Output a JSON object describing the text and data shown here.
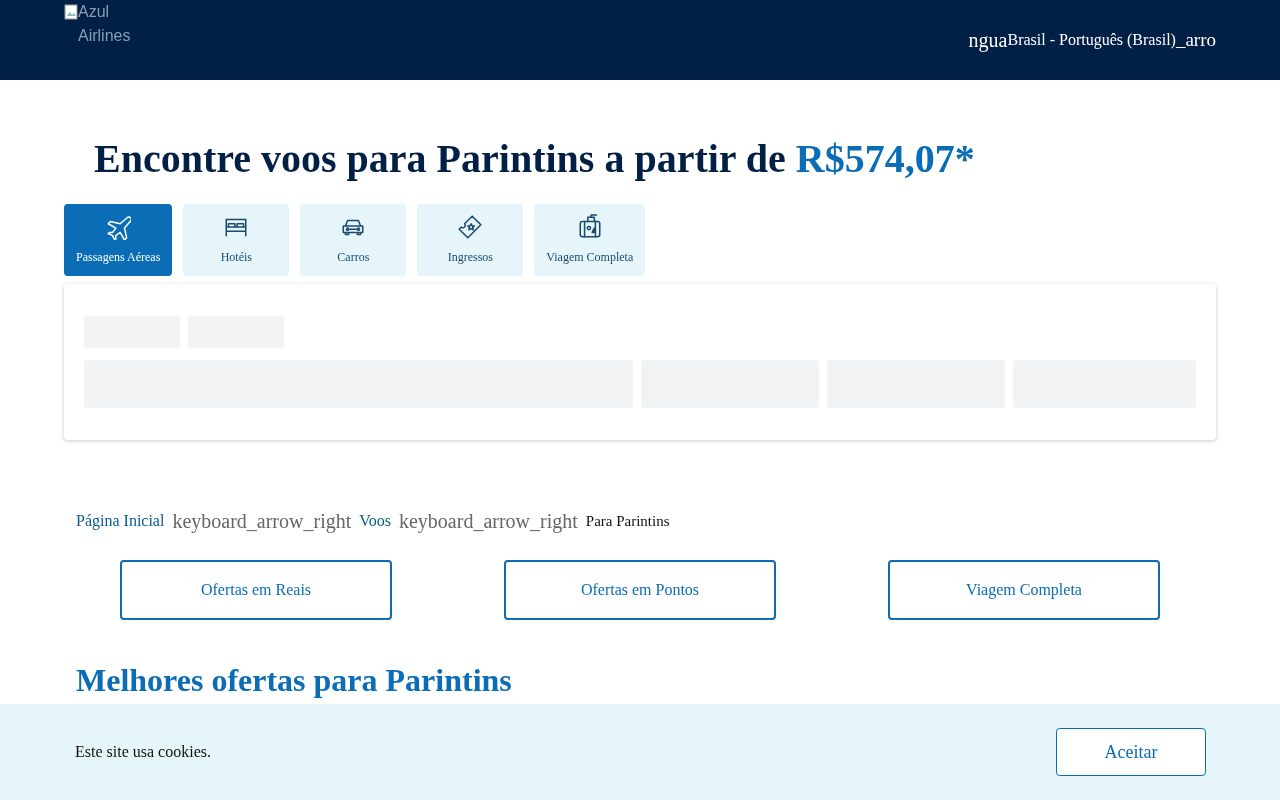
{
  "header": {
    "logo_alt": "Azul Airlines",
    "language_label": "ngua",
    "language_value": "Brasil - Português (Brasil)",
    "language_arrow": "_arro"
  },
  "hero": {
    "title": "Encontre voos para Parintins a partir de",
    "price": "R$574,07*"
  },
  "tabs": [
    {
      "label": "Passagens Aéreas",
      "kind": "plane",
      "selected": true
    },
    {
      "label": "Hotéis",
      "kind": "bed",
      "selected": false
    },
    {
      "label": "Carros",
      "kind": "car",
      "selected": false
    },
    {
      "label": "Ingressos",
      "kind": "ticket",
      "selected": false
    },
    {
      "label": "Viagem Completa",
      "kind": "luggage",
      "selected": false
    }
  ],
  "breadcrumb": [
    {
      "label": "Página Inicial",
      "kind": "link"
    },
    {
      "label": "keyboard_arrow_right",
      "kind": "separator"
    },
    {
      "label": "Voos",
      "kind": "link"
    },
    {
      "label": "keyboard_arrow_right",
      "kind": "separator"
    },
    {
      "label": "Para Parintins",
      "kind": "current"
    }
  ],
  "offer_buttons": [
    "Ofertas em Reais",
    "Ofertas em Pontos",
    "Viagem Completa"
  ],
  "section_title": "Melhores ofertas para Parintins",
  "cookie_banner": {
    "message": "Este site usa cookies.",
    "button": "Aceitar"
  }
}
